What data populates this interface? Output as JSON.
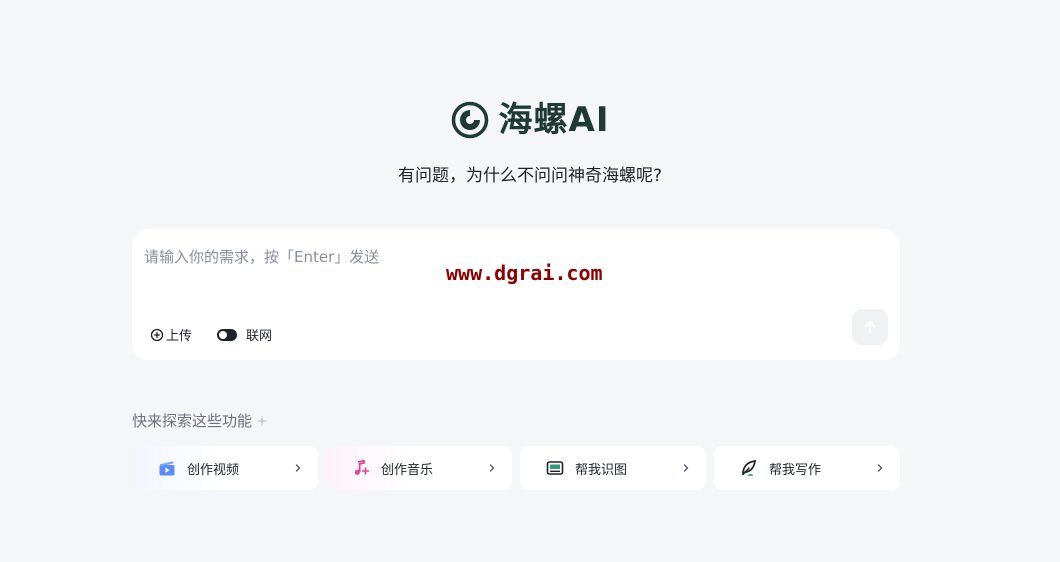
{
  "brand": {
    "name": "海螺AI",
    "tagline": "有问题，为什么不问问神奇海螺呢?",
    "color": "#1e3a32"
  },
  "chat": {
    "placeholder": "请输入你的需求，按「Enter」发送",
    "watermark": "www.dgrai.com",
    "upload_label": "上传",
    "web_label": "联网",
    "web_enabled": true
  },
  "explore": {
    "title": "快来探索这些功能",
    "features": [
      {
        "label": "创作视频",
        "icon": "video-icon",
        "color": "#4f7cf6"
      },
      {
        "label": "创作音乐",
        "icon": "music-icon",
        "color": "#e0468f"
      },
      {
        "label": "帮我识图",
        "icon": "image-icon",
        "color": "#1f2329"
      },
      {
        "label": "帮我写作",
        "icon": "feather-pen-icon",
        "color": "#1f2329"
      }
    ]
  }
}
